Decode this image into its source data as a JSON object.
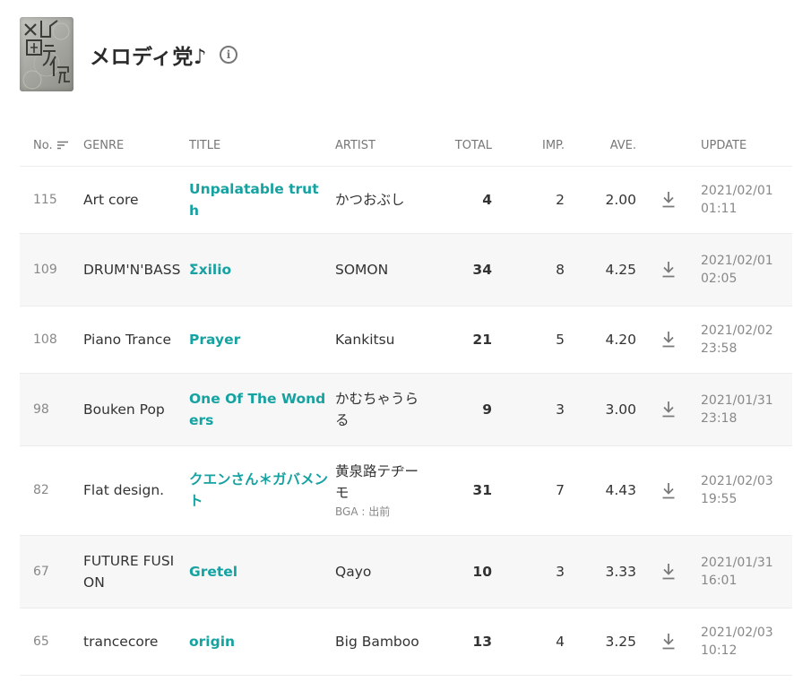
{
  "team": {
    "name": "メロディ党♪",
    "info_icon": "info-icon",
    "logo_icon": "team-logo"
  },
  "columns": {
    "no": "No.",
    "genre": "GENRE",
    "title": "TITLE",
    "artist": "ARTIST",
    "total": "TOTAL",
    "imp": "IMP.",
    "ave": "AVE.",
    "update": "UPDATE"
  },
  "accent_color": "#17a2a2",
  "rows": [
    {
      "no": "115",
      "genre": "Art core",
      "title": "Unpalatable truth",
      "artist": "かつおぶし",
      "bga": "",
      "total": "4",
      "imp": "2",
      "ave": "2.00",
      "date": "2021/02/01",
      "time": "01:11"
    },
    {
      "no": "109",
      "genre": "DRUM'N'BASS",
      "title": "Σxilio",
      "artist": "SOMON",
      "bga": "",
      "total": "34",
      "imp": "8",
      "ave": "4.25",
      "date": "2021/02/01",
      "time": "02:05"
    },
    {
      "no": "108",
      "genre": "Piano Trance",
      "title": "Prayer",
      "artist": "Kankitsu",
      "bga": "",
      "total": "21",
      "imp": "5",
      "ave": "4.20",
      "date": "2021/02/02",
      "time": "23:58"
    },
    {
      "no": "98",
      "genre": "Bouken Pop",
      "title": "One Of The Wonders",
      "artist": "かむちゃうらる",
      "bga": "",
      "total": "9",
      "imp": "3",
      "ave": "3.00",
      "date": "2021/01/31",
      "time": "23:18"
    },
    {
      "no": "82",
      "genre": "Flat design.",
      "title": "クエンさん＊ガバメント",
      "artist": "黄泉路テヂーモ",
      "bga": "BGA : 出前",
      "total": "31",
      "imp": "7",
      "ave": "4.43",
      "date": "2021/02/03",
      "time": "19:55"
    },
    {
      "no": "67",
      "genre": "FUTURE FUSION",
      "title": "Gretel",
      "artist": "Qayo",
      "bga": "",
      "total": "10",
      "imp": "3",
      "ave": "3.33",
      "date": "2021/01/31",
      "time": "16:01"
    },
    {
      "no": "65",
      "genre": "trancecore",
      "title": "origin",
      "artist": "Big Bamboo",
      "bga": "",
      "total": "13",
      "imp": "4",
      "ave": "3.25",
      "date": "2021/02/03",
      "time": "10:12"
    }
  ]
}
